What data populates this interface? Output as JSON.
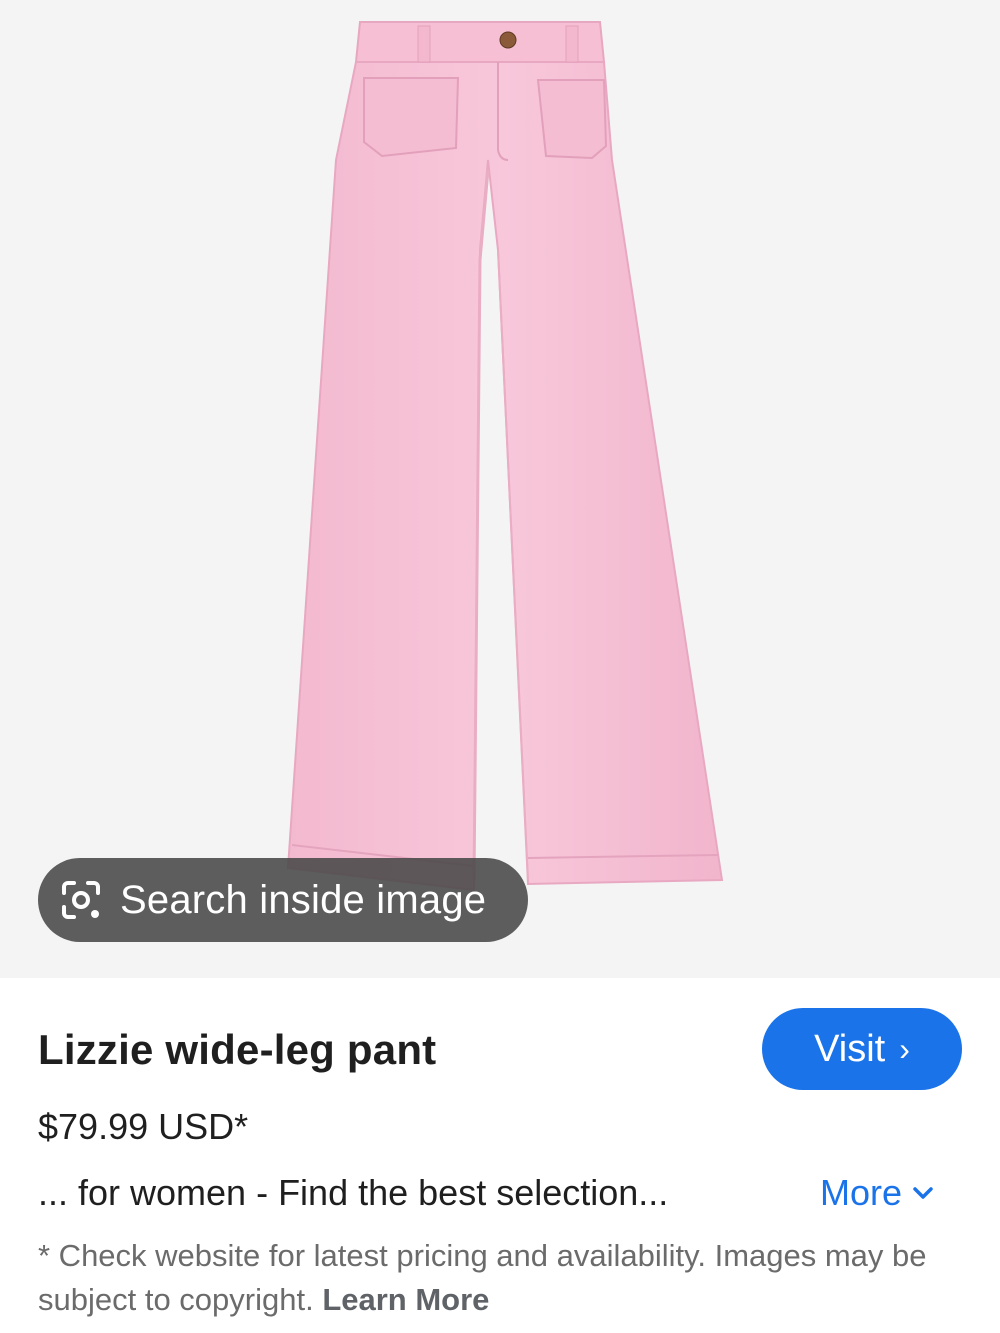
{
  "image": {
    "alt": "Pink wide-leg pants product photo",
    "search_chip_label": "Search inside image",
    "search_chip_icon": "lens-icon"
  },
  "product": {
    "title": "Lizzie wide-leg pant",
    "price": "$79.99 USD*",
    "snippet": "... for women - Find the best selection...",
    "visit_label": "Visit",
    "more_label": "More"
  },
  "disclaimer": {
    "text": "* Check website for latest pricing and availability. Images may be subject to copyright.",
    "learn_more": "Learn More"
  },
  "colors": {
    "accent": "#1a73e8",
    "pants": "#f7c4d8",
    "image_bg": "#f4f4f4"
  }
}
